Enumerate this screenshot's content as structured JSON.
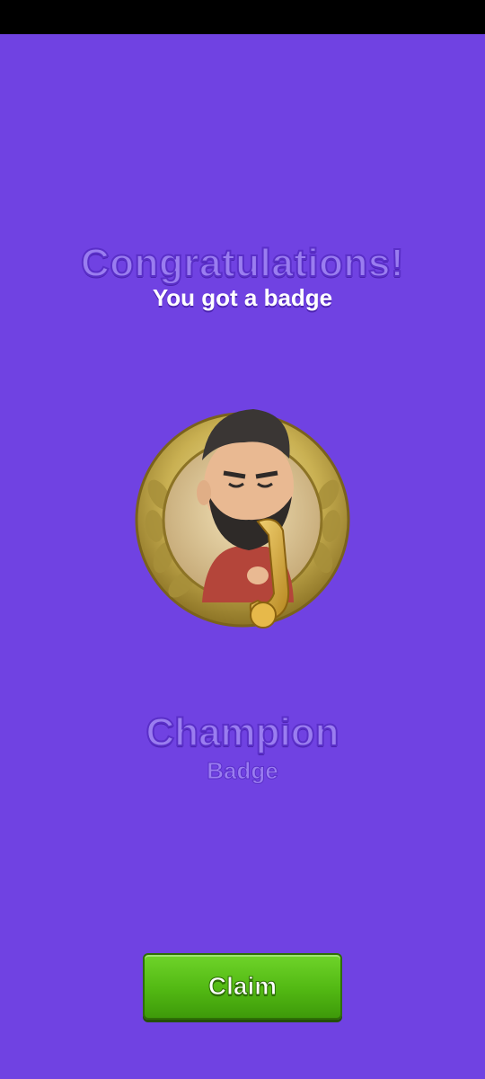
{
  "colors": {
    "background": "#7042E2",
    "status_bar": "#000000",
    "title_fill": "#9A7DF0",
    "button_green": "#52B813"
  },
  "header": {
    "title": "Congratulations!",
    "subtitle": "You got a badge"
  },
  "badge": {
    "image": "saxophone-player-gold-laurel-badge-icon",
    "name": "Champion",
    "type": "Badge"
  },
  "actions": {
    "claim_label": "Claim"
  }
}
